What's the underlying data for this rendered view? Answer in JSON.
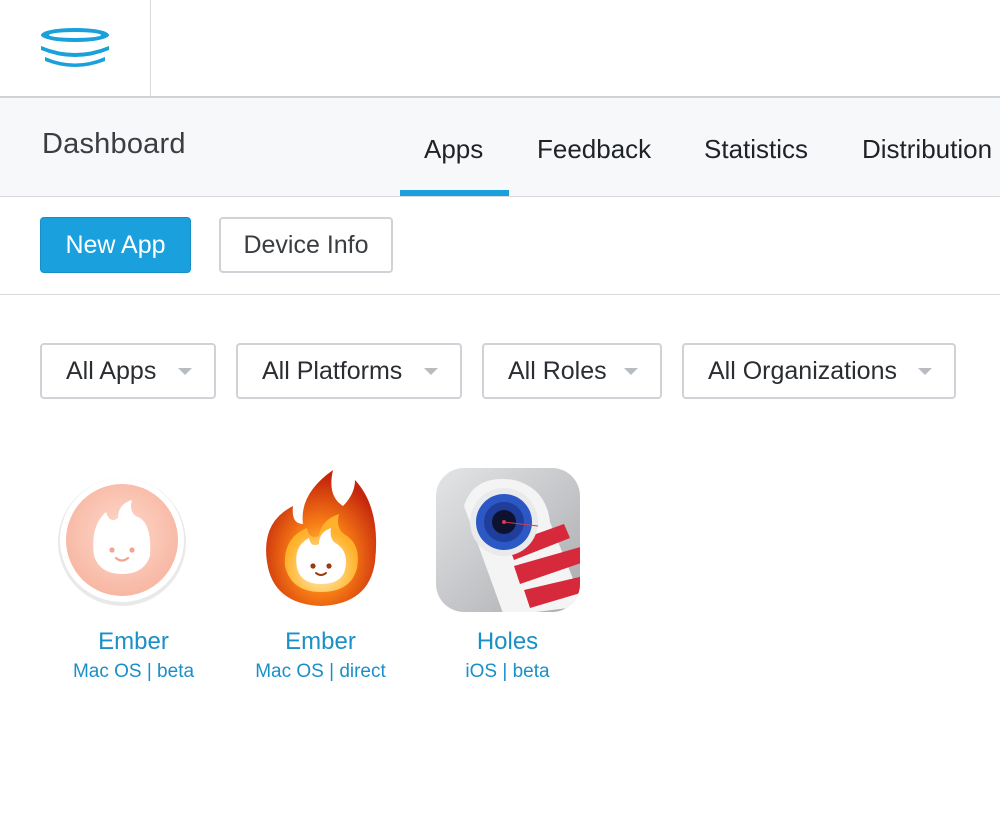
{
  "header": {
    "logo_icon": "stacked-rings-logo-icon",
    "accent_color": "#1aa0db"
  },
  "nav": {
    "title": "Dashboard",
    "tabs": [
      {
        "label": "Apps",
        "active": true
      },
      {
        "label": "Feedback",
        "active": false
      },
      {
        "label": "Statistics",
        "active": false
      },
      {
        "label": "Distribution",
        "active": false
      }
    ]
  },
  "actions": {
    "new_app_label": "New App",
    "device_info_label": "Device Info"
  },
  "filters": [
    {
      "label": "All Apps"
    },
    {
      "label": "All Platforms"
    },
    {
      "label": "All Roles"
    },
    {
      "label": "All Organizations"
    }
  ],
  "apps": [
    {
      "name": "Ember",
      "subtitle": "Mac OS | beta",
      "icon": "ember-beta-icon"
    },
    {
      "name": "Ember",
      "subtitle": "Mac OS | direct",
      "icon": "ember-fire-icon"
    },
    {
      "name": "Holes",
      "subtitle": "iOS | beta",
      "icon": "holes-icon"
    }
  ]
}
